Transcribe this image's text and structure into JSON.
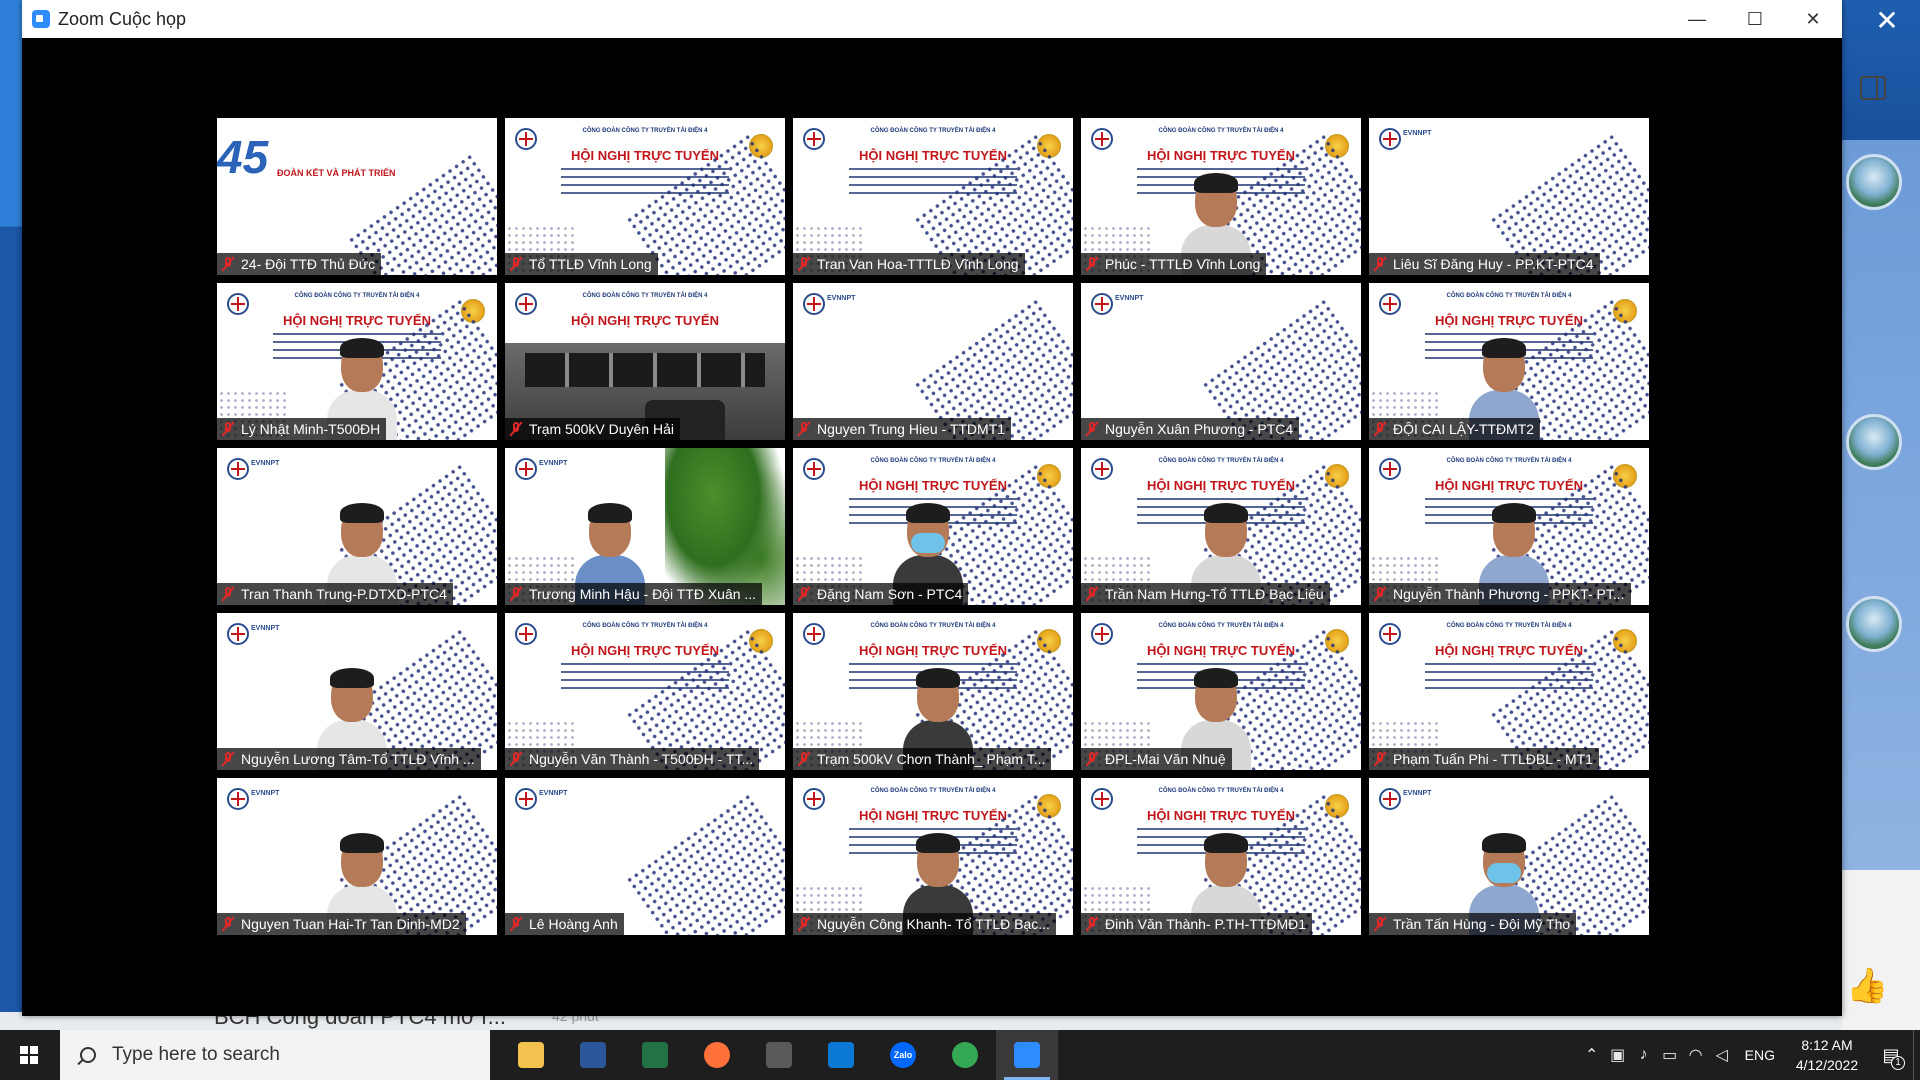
{
  "window": {
    "title": "Zoom Cuộc họp",
    "minimize_glyph": "—",
    "maximize_glyph": "☐",
    "close_glyph": "✕"
  },
  "desktop": {
    "close_glyph": "✕",
    "behind_text": "BCH Công đoàn PTC4 mở r...",
    "behind_time": "42 phút",
    "thumb_glyph": "👍"
  },
  "participants": [
    {
      "name": "24- Đội TTĐ Thủ Đức",
      "muted": true,
      "bg": "anniversary",
      "person": false
    },
    {
      "name": "Tổ TTLĐ Vĩnh Long",
      "muted": true,
      "bg": "slide",
      "person": false
    },
    {
      "name": "Tran Van Hoa-TTTLĐ Vĩnh Long",
      "muted": true,
      "bg": "slide",
      "person": false
    },
    {
      "name": "Phúc - TTTLĐ Vĩnh Long",
      "muted": true,
      "bg": "slide",
      "person": true
    },
    {
      "name": "Liêu Sĩ Đăng Huy - PP.KT-PTC4",
      "muted": true,
      "bg": "evn",
      "person": false
    },
    {
      "name": "Lý Nhật Minh-T500ĐH",
      "muted": true,
      "bg": "slide",
      "person": true
    },
    {
      "name": "Trạm 500kV Duyên Hải",
      "muted": true,
      "bg": "control",
      "person": false
    },
    {
      "name": "Nguyen Trung Hieu - TTDMT1",
      "muted": true,
      "bg": "evn",
      "person": false
    },
    {
      "name": "Nguyễn Xuân Phương - PTC4",
      "muted": true,
      "bg": "evn",
      "person": false
    },
    {
      "name": "ĐỘI CAI LẬY-TTĐMT2",
      "muted": true,
      "bg": "slide",
      "person": true
    },
    {
      "name": "Tran Thanh Trung-P.DTXD-PTC4",
      "muted": true,
      "bg": "evn",
      "person": true
    },
    {
      "name": "Trương Minh Hậu - Đội TTĐ Xuân ...",
      "muted": true,
      "bg": "plant",
      "person": true
    },
    {
      "name": "Đặng Nam Sơn - PTC4",
      "muted": true,
      "bg": "slide",
      "person": true,
      "mask": true
    },
    {
      "name": "Trần Nam Hưng-Tổ TTLĐ Bạc Liêu",
      "muted": true,
      "bg": "slide",
      "person": true
    },
    {
      "name": "Nguyễn Thành Phương - PPKT- PT...",
      "muted": true,
      "bg": "slide",
      "person": true
    },
    {
      "name": "Nguyễn Lương Tâm-Tổ TTLĐ Vĩnh ...",
      "muted": true,
      "bg": "evn",
      "person": true
    },
    {
      "name": "Nguyễn Văn Thành - T500ĐH - TT...",
      "muted": true,
      "bg": "slide",
      "person": false
    },
    {
      "name": "Trạm 500kV Chơn Thành_ Phạm T...",
      "muted": true,
      "bg": "slide",
      "person": true
    },
    {
      "name": "ĐPL-Mai Văn Nhuệ",
      "muted": true,
      "bg": "slide",
      "person": true
    },
    {
      "name": "Phạm Tuấn Phi - TTLĐBL - MT1",
      "muted": true,
      "bg": "slide",
      "person": false
    },
    {
      "name": "Nguyen Tuan Hai-Tr Tan Dinh-MD2",
      "muted": true,
      "bg": "evn",
      "person": true
    },
    {
      "name": "Lê Hoàng Anh",
      "muted": true,
      "bg": "evn",
      "person": false
    },
    {
      "name": "Nguyễn Công Khanh- Tổ TTLĐ Bạc...",
      "muted": true,
      "bg": "slide",
      "person": true
    },
    {
      "name": "Đinh Văn Thành- P.TH-TTĐMĐ1",
      "muted": true,
      "bg": "slide",
      "person": true
    },
    {
      "name": "Trần Tấn Hùng - Đội Mỹ Tho",
      "muted": true,
      "bg": "evn",
      "person": true,
      "mask": true
    }
  ],
  "slide": {
    "header": "CÔNG ĐOÀN CÔNG TY TRUYỀN TẢI ĐIỆN 4",
    "title": "HỘI NGHỊ TRỰC TUYẾN",
    "evn": "EVNNPT",
    "anniversary_number": "45",
    "anniversary_text": "ĐOÀN KẾT VÀ PHÁT TRIỂN"
  },
  "taskbar": {
    "search_placeholder": "Type here to search",
    "language": "ENG",
    "time": "8:12 AM",
    "date": "4/12/2022",
    "notification_count": "1",
    "apps": [
      {
        "name": "file-explorer",
        "color": "#f2c14e",
        "active": false
      },
      {
        "name": "word",
        "color": "#2b579a",
        "active": false
      },
      {
        "name": "excel",
        "color": "#217346",
        "active": false
      },
      {
        "name": "firefox",
        "color": "#ff7139",
        "active": false
      },
      {
        "name": "media-app",
        "color": "#5a5a5a",
        "active": false
      },
      {
        "name": "mail",
        "color": "#0a78d4",
        "active": false
      },
      {
        "name": "zalo",
        "color": "#0068ff",
        "active": false
      },
      {
        "name": "chrome",
        "color": "#34a853",
        "active": false
      },
      {
        "name": "zoom",
        "color": "#2d8cff",
        "active": true
      }
    ],
    "zalo_label": "Zalo"
  }
}
